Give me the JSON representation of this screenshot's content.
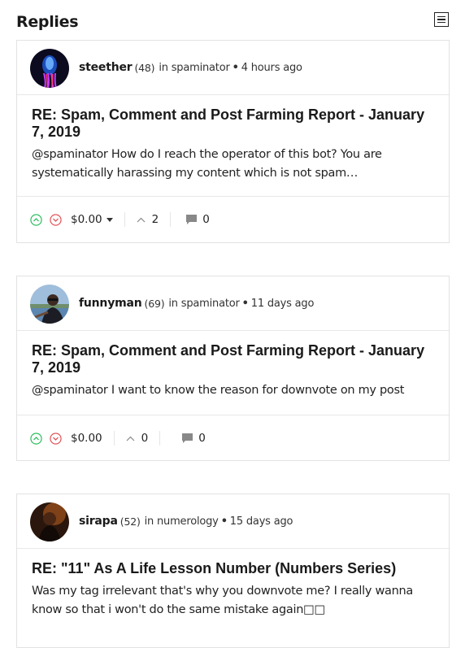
{
  "section_title": "Replies",
  "replies": [
    {
      "author": "steether",
      "reputation": "(48)",
      "community_prefix": "in",
      "community": "spaminator",
      "dot": "•",
      "age": "4 hours ago",
      "title": "RE: Spam, Comment and Post Farming Report - January 7, 2019",
      "body": "@spaminator How do I reach the operator of this bot? You are systematically harassing my content which is not spam…",
      "payout": "$0.00",
      "votes": "2",
      "comments": "0",
      "has_payout_dropdown": true
    },
    {
      "author": "funnyman",
      "reputation": "(69)",
      "community_prefix": "in",
      "community": "spaminator",
      "dot": "•",
      "age": "11 days ago",
      "title": "RE: Spam, Comment and Post Farming Report - January 7, 2019",
      "body": "@spaminator I want to know the reason for downvote on my post",
      "payout": "$0.00",
      "votes": "0",
      "comments": "0",
      "has_payout_dropdown": false
    },
    {
      "author": "sirapa",
      "reputation": "(52)",
      "community_prefix": "in",
      "community": "numerology",
      "dot": "•",
      "age": "15 days ago",
      "title": "RE: \"11\" As A Life Lesson Number (Numbers Series)",
      "body": "Was my tag irrelevant that's why you downvote me? I really wanna know so that i won't do the same mistake again□□"
    }
  ],
  "icons": {
    "menu": "hamburger-menu-icon",
    "upvote": "upvote-circle-icon",
    "downvote": "downvote-circle-icon",
    "votes": "chevron-up-icon",
    "comments": "comment-bubble-icon"
  },
  "colors": {
    "upvote": "#1db954",
    "downvote": "#e0464b",
    "border": "#e2e2e2"
  }
}
